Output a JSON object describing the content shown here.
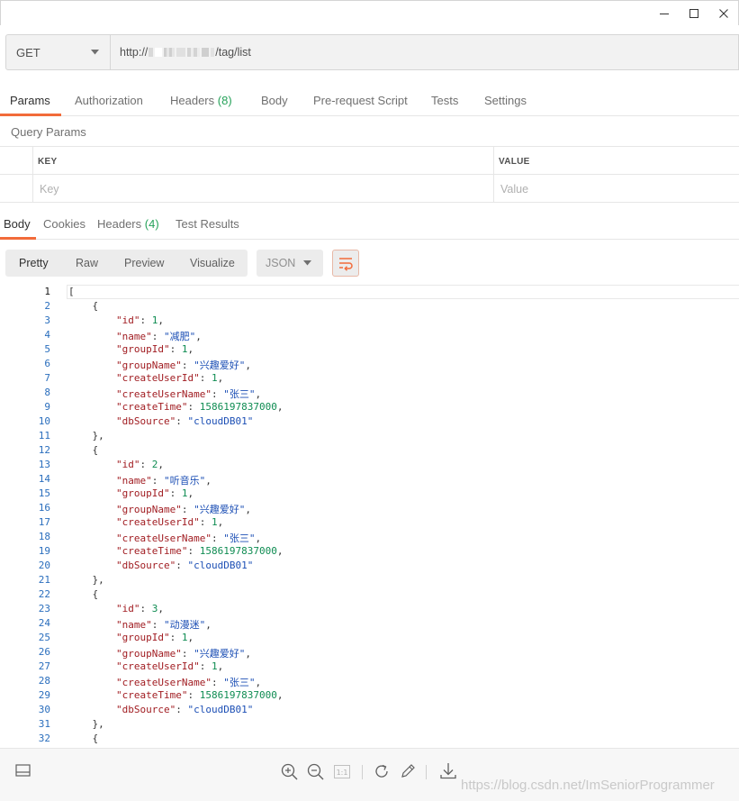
{
  "window": {
    "controls": [
      {
        "name": "minimize-icon"
      },
      {
        "name": "maximize-icon"
      },
      {
        "name": "close-icon"
      }
    ]
  },
  "request": {
    "method": "GET",
    "url_prefix": "http://",
    "url_suffix": "/tag/list"
  },
  "request_tabs": [
    {
      "label": "Params",
      "count": ""
    },
    {
      "label": "Authorization",
      "count": ""
    },
    {
      "label": "Headers",
      "count": "(8)"
    },
    {
      "label": "Body",
      "count": ""
    },
    {
      "label": "Pre-request Script",
      "count": ""
    },
    {
      "label": "Tests",
      "count": ""
    },
    {
      "label": "Settings",
      "count": ""
    }
  ],
  "query_params": {
    "title": "Query Params",
    "key_header": "KEY",
    "value_header": "VALUE",
    "key_placeholder": "Key",
    "value_placeholder": "Value"
  },
  "response_tabs": [
    {
      "label": "Body",
      "count": ""
    },
    {
      "label": "Cookies",
      "count": ""
    },
    {
      "label": "Headers",
      "count": "(4)"
    },
    {
      "label": "Test Results",
      "count": ""
    }
  ],
  "view_modes": [
    "Pretty",
    "Raw",
    "Preview",
    "Visualize"
  ],
  "format": "JSON",
  "colors": {
    "accent": "#f26b3a",
    "count_green": "#26a25a",
    "json_key": "#a11d22",
    "json_number": "#0f8c52",
    "json_string": "#1c4fb5",
    "line_number": "#2a6ebd"
  },
  "code_lines": [
    {
      "n": "1",
      "indent": 0,
      "parts": [
        {
          "t": "p",
          "v": "["
        }
      ]
    },
    {
      "n": "2",
      "indent": 1,
      "parts": [
        {
          "t": "p",
          "v": "{"
        }
      ]
    },
    {
      "n": "3",
      "indent": 2,
      "parts": [
        {
          "t": "k",
          "v": "\"id\""
        },
        {
          "t": "p",
          "v": ": "
        },
        {
          "t": "n",
          "v": "1"
        },
        {
          "t": "p",
          "v": ","
        }
      ]
    },
    {
      "n": "4",
      "indent": 2,
      "parts": [
        {
          "t": "k",
          "v": "\"name\""
        },
        {
          "t": "p",
          "v": ": "
        },
        {
          "t": "s",
          "v": "\"减肥\""
        },
        {
          "t": "p",
          "v": ","
        }
      ]
    },
    {
      "n": "5",
      "indent": 2,
      "parts": [
        {
          "t": "k",
          "v": "\"groupId\""
        },
        {
          "t": "p",
          "v": ": "
        },
        {
          "t": "n",
          "v": "1"
        },
        {
          "t": "p",
          "v": ","
        }
      ]
    },
    {
      "n": "6",
      "indent": 2,
      "parts": [
        {
          "t": "k",
          "v": "\"groupName\""
        },
        {
          "t": "p",
          "v": ": "
        },
        {
          "t": "s",
          "v": "\"兴趣爱好\""
        },
        {
          "t": "p",
          "v": ","
        }
      ]
    },
    {
      "n": "7",
      "indent": 2,
      "parts": [
        {
          "t": "k",
          "v": "\"createUserId\""
        },
        {
          "t": "p",
          "v": ": "
        },
        {
          "t": "n",
          "v": "1"
        },
        {
          "t": "p",
          "v": ","
        }
      ]
    },
    {
      "n": "8",
      "indent": 2,
      "parts": [
        {
          "t": "k",
          "v": "\"createUserName\""
        },
        {
          "t": "p",
          "v": ": "
        },
        {
          "t": "s",
          "v": "\"张三\""
        },
        {
          "t": "p",
          "v": ","
        }
      ]
    },
    {
      "n": "9",
      "indent": 2,
      "parts": [
        {
          "t": "k",
          "v": "\"createTime\""
        },
        {
          "t": "p",
          "v": ": "
        },
        {
          "t": "n",
          "v": "1586197837000"
        },
        {
          "t": "p",
          "v": ","
        }
      ]
    },
    {
      "n": "10",
      "indent": 2,
      "parts": [
        {
          "t": "k",
          "v": "\"dbSource\""
        },
        {
          "t": "p",
          "v": ": "
        },
        {
          "t": "s",
          "v": "\"cloudDB01\""
        }
      ]
    },
    {
      "n": "11",
      "indent": 1,
      "parts": [
        {
          "t": "p",
          "v": "},"
        }
      ]
    },
    {
      "n": "12",
      "indent": 1,
      "parts": [
        {
          "t": "p",
          "v": "{"
        }
      ]
    },
    {
      "n": "13",
      "indent": 2,
      "parts": [
        {
          "t": "k",
          "v": "\"id\""
        },
        {
          "t": "p",
          "v": ": "
        },
        {
          "t": "n",
          "v": "2"
        },
        {
          "t": "p",
          "v": ","
        }
      ]
    },
    {
      "n": "14",
      "indent": 2,
      "parts": [
        {
          "t": "k",
          "v": "\"name\""
        },
        {
          "t": "p",
          "v": ": "
        },
        {
          "t": "s",
          "v": "\"听音乐\""
        },
        {
          "t": "p",
          "v": ","
        }
      ]
    },
    {
      "n": "15",
      "indent": 2,
      "parts": [
        {
          "t": "k",
          "v": "\"groupId\""
        },
        {
          "t": "p",
          "v": ": "
        },
        {
          "t": "n",
          "v": "1"
        },
        {
          "t": "p",
          "v": ","
        }
      ]
    },
    {
      "n": "16",
      "indent": 2,
      "parts": [
        {
          "t": "k",
          "v": "\"groupName\""
        },
        {
          "t": "p",
          "v": ": "
        },
        {
          "t": "s",
          "v": "\"兴趣爱好\""
        },
        {
          "t": "p",
          "v": ","
        }
      ]
    },
    {
      "n": "17",
      "indent": 2,
      "parts": [
        {
          "t": "k",
          "v": "\"createUserId\""
        },
        {
          "t": "p",
          "v": ": "
        },
        {
          "t": "n",
          "v": "1"
        },
        {
          "t": "p",
          "v": ","
        }
      ]
    },
    {
      "n": "18",
      "indent": 2,
      "parts": [
        {
          "t": "k",
          "v": "\"createUserName\""
        },
        {
          "t": "p",
          "v": ": "
        },
        {
          "t": "s",
          "v": "\"张三\""
        },
        {
          "t": "p",
          "v": ","
        }
      ]
    },
    {
      "n": "19",
      "indent": 2,
      "parts": [
        {
          "t": "k",
          "v": "\"createTime\""
        },
        {
          "t": "p",
          "v": ": "
        },
        {
          "t": "n",
          "v": "1586197837000"
        },
        {
          "t": "p",
          "v": ","
        }
      ]
    },
    {
      "n": "20",
      "indent": 2,
      "parts": [
        {
          "t": "k",
          "v": "\"dbSource\""
        },
        {
          "t": "p",
          "v": ": "
        },
        {
          "t": "s",
          "v": "\"cloudDB01\""
        }
      ]
    },
    {
      "n": "21",
      "indent": 1,
      "parts": [
        {
          "t": "p",
          "v": "},"
        }
      ]
    },
    {
      "n": "22",
      "indent": 1,
      "parts": [
        {
          "t": "p",
          "v": "{"
        }
      ]
    },
    {
      "n": "23",
      "indent": 2,
      "parts": [
        {
          "t": "k",
          "v": "\"id\""
        },
        {
          "t": "p",
          "v": ": "
        },
        {
          "t": "n",
          "v": "3"
        },
        {
          "t": "p",
          "v": ","
        }
      ]
    },
    {
      "n": "24",
      "indent": 2,
      "parts": [
        {
          "t": "k",
          "v": "\"name\""
        },
        {
          "t": "p",
          "v": ": "
        },
        {
          "t": "s",
          "v": "\"动漫迷\""
        },
        {
          "t": "p",
          "v": ","
        }
      ]
    },
    {
      "n": "25",
      "indent": 2,
      "parts": [
        {
          "t": "k",
          "v": "\"groupId\""
        },
        {
          "t": "p",
          "v": ": "
        },
        {
          "t": "n",
          "v": "1"
        },
        {
          "t": "p",
          "v": ","
        }
      ]
    },
    {
      "n": "26",
      "indent": 2,
      "parts": [
        {
          "t": "k",
          "v": "\"groupName\""
        },
        {
          "t": "p",
          "v": ": "
        },
        {
          "t": "s",
          "v": "\"兴趣爱好\""
        },
        {
          "t": "p",
          "v": ","
        }
      ]
    },
    {
      "n": "27",
      "indent": 2,
      "parts": [
        {
          "t": "k",
          "v": "\"createUserId\""
        },
        {
          "t": "p",
          "v": ": "
        },
        {
          "t": "n",
          "v": "1"
        },
        {
          "t": "p",
          "v": ","
        }
      ]
    },
    {
      "n": "28",
      "indent": 2,
      "parts": [
        {
          "t": "k",
          "v": "\"createUserName\""
        },
        {
          "t": "p",
          "v": ": "
        },
        {
          "t": "s",
          "v": "\"张三\""
        },
        {
          "t": "p",
          "v": ","
        }
      ]
    },
    {
      "n": "29",
      "indent": 2,
      "parts": [
        {
          "t": "k",
          "v": "\"createTime\""
        },
        {
          "t": "p",
          "v": ": "
        },
        {
          "t": "n",
          "v": "1586197837000"
        },
        {
          "t": "p",
          "v": ","
        }
      ]
    },
    {
      "n": "30",
      "indent": 2,
      "parts": [
        {
          "t": "k",
          "v": "\"dbSource\""
        },
        {
          "t": "p",
          "v": ": "
        },
        {
          "t": "s",
          "v": "\"cloudDB01\""
        }
      ]
    },
    {
      "n": "31",
      "indent": 1,
      "parts": [
        {
          "t": "p",
          "v": "},"
        }
      ]
    },
    {
      "n": "32",
      "indent": 1,
      "parts": [
        {
          "t": "p",
          "v": "{"
        }
      ]
    }
  ],
  "status_bar": {
    "icons": [
      "layout-icon",
      "zoom-in-icon",
      "zoom-out-icon",
      "actual-size-icon",
      "refresh-icon",
      "edit-icon",
      "download-icon"
    ]
  },
  "watermark": "https://blog.csdn.net/ImSeniorProgrammer"
}
